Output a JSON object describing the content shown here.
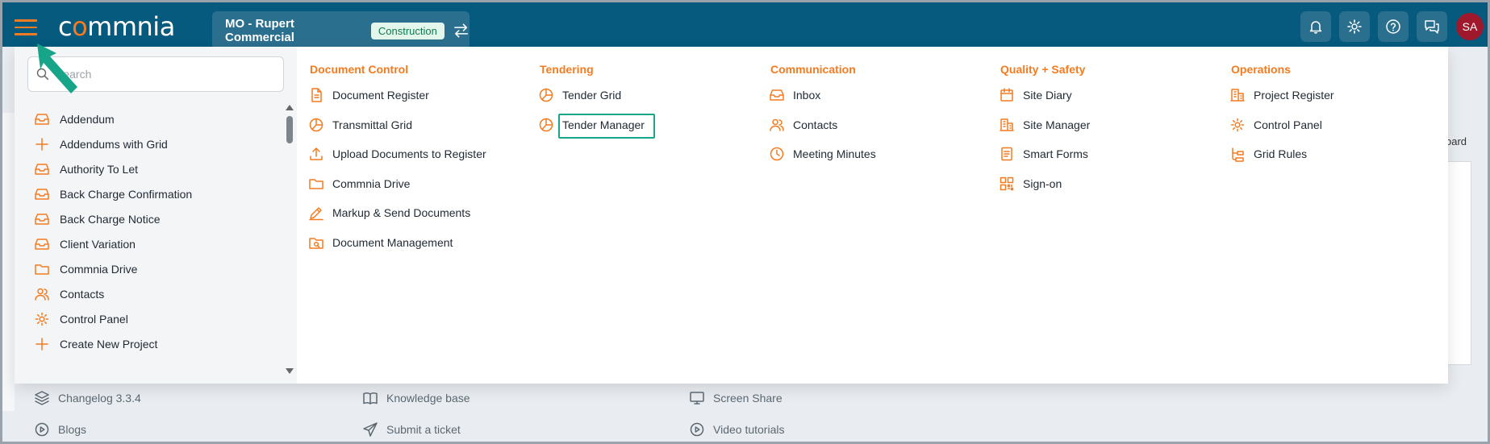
{
  "topbar": {
    "logo_text_a": "c",
    "logo_text_o": "o",
    "logo_text_b": "mmnia",
    "project_name": "MO - Rupert Commercial",
    "project_badge": "Construction",
    "avatar_initials": "SA",
    "icons": [
      "bell-icon",
      "gear-icon",
      "help-icon",
      "chat-icon"
    ]
  },
  "search": {
    "placeholder": "Search"
  },
  "left_list": [
    {
      "label": "Addendum",
      "icon": "inbox-icon"
    },
    {
      "label": "Addendums with Grid",
      "icon": "plus-icon"
    },
    {
      "label": "Authority To Let",
      "icon": "inbox-icon"
    },
    {
      "label": "Back Charge Confirmation",
      "icon": "inbox-icon"
    },
    {
      "label": "Back Charge Notice",
      "icon": "inbox-icon"
    },
    {
      "label": "Client Variation",
      "icon": "inbox-icon"
    },
    {
      "label": "Commnia Drive",
      "icon": "folder-icon"
    },
    {
      "label": "Contacts",
      "icon": "users-icon"
    },
    {
      "label": "Control Panel",
      "icon": "gear-icon"
    },
    {
      "label": "Create New Project",
      "icon": "plus-icon"
    }
  ],
  "columns": [
    {
      "title": "Document Control",
      "items": [
        {
          "label": "Document Register",
          "icon": "document-icon"
        },
        {
          "label": "Transmittal Grid",
          "icon": "pie-chart-icon"
        },
        {
          "label": "Upload Documents to Register",
          "icon": "upload-icon"
        },
        {
          "label": "Commnia Drive",
          "icon": "folder-icon"
        },
        {
          "label": "Markup & Send Documents",
          "icon": "pen-icon"
        },
        {
          "label": "Document Management",
          "icon": "folder-search-icon"
        }
      ]
    },
    {
      "title": "Tendering",
      "items": [
        {
          "label": "Tender Grid",
          "icon": "pie-chart-icon"
        },
        {
          "label": "Tender Manager",
          "icon": "pie-chart-icon"
        }
      ]
    },
    {
      "title": "Communication",
      "items": [
        {
          "label": "Inbox",
          "icon": "inbox-icon"
        },
        {
          "label": "Contacts",
          "icon": "users-icon"
        },
        {
          "label": "Meeting Minutes",
          "icon": "clock-icon"
        }
      ]
    },
    {
      "title": "Quality + Safety",
      "items": [
        {
          "label": "Site Diary",
          "icon": "calendar-icon"
        },
        {
          "label": "Site Manager",
          "icon": "building-icon"
        },
        {
          "label": "Smart Forms",
          "icon": "form-icon"
        },
        {
          "label": "Sign-on",
          "icon": "qr-icon"
        }
      ]
    },
    {
      "title": "Operations",
      "items": [
        {
          "label": "Project Register",
          "icon": "building-icon"
        },
        {
          "label": "Control Panel",
          "icon": "gear-icon"
        },
        {
          "label": "Grid Rules",
          "icon": "flow-icon"
        }
      ]
    }
  ],
  "footer": [
    {
      "label": "Changelog 3.3.4",
      "icon": "layers-icon"
    },
    {
      "label": "Knowledge base",
      "icon": "book-icon"
    },
    {
      "label": "Screen Share",
      "icon": "screen-icon"
    },
    {
      "label": "Blogs",
      "icon": "play-icon"
    },
    {
      "label": "Submit a ticket",
      "icon": "send-icon"
    },
    {
      "label": "Video tutorials",
      "icon": "play-icon"
    }
  ],
  "background": {
    "partial_text": "oard"
  },
  "colors": {
    "brand": "#055a7e",
    "accent": "#f47b20",
    "highlight": "#17a589",
    "arrow": "#17a589"
  }
}
